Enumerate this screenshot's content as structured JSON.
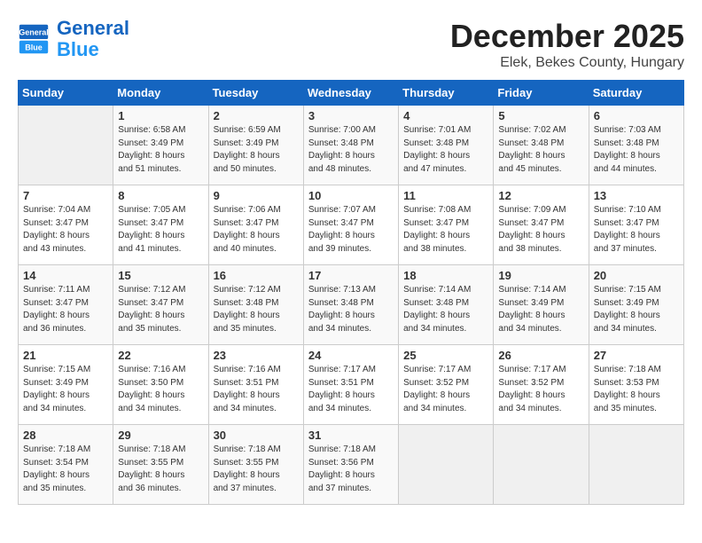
{
  "header": {
    "logo_line1": "General",
    "logo_line2": "Blue",
    "month": "December 2025",
    "location": "Elek, Bekes County, Hungary"
  },
  "days_of_week": [
    "Sunday",
    "Monday",
    "Tuesday",
    "Wednesday",
    "Thursday",
    "Friday",
    "Saturday"
  ],
  "weeks": [
    [
      {
        "day": "",
        "info": ""
      },
      {
        "day": "1",
        "info": "Sunrise: 6:58 AM\nSunset: 3:49 PM\nDaylight: 8 hours\nand 51 minutes."
      },
      {
        "day": "2",
        "info": "Sunrise: 6:59 AM\nSunset: 3:49 PM\nDaylight: 8 hours\nand 50 minutes."
      },
      {
        "day": "3",
        "info": "Sunrise: 7:00 AM\nSunset: 3:48 PM\nDaylight: 8 hours\nand 48 minutes."
      },
      {
        "day": "4",
        "info": "Sunrise: 7:01 AM\nSunset: 3:48 PM\nDaylight: 8 hours\nand 47 minutes."
      },
      {
        "day": "5",
        "info": "Sunrise: 7:02 AM\nSunset: 3:48 PM\nDaylight: 8 hours\nand 45 minutes."
      },
      {
        "day": "6",
        "info": "Sunrise: 7:03 AM\nSunset: 3:48 PM\nDaylight: 8 hours\nand 44 minutes."
      }
    ],
    [
      {
        "day": "7",
        "info": "Sunrise: 7:04 AM\nSunset: 3:47 PM\nDaylight: 8 hours\nand 43 minutes."
      },
      {
        "day": "8",
        "info": "Sunrise: 7:05 AM\nSunset: 3:47 PM\nDaylight: 8 hours\nand 41 minutes."
      },
      {
        "day": "9",
        "info": "Sunrise: 7:06 AM\nSunset: 3:47 PM\nDaylight: 8 hours\nand 40 minutes."
      },
      {
        "day": "10",
        "info": "Sunrise: 7:07 AM\nSunset: 3:47 PM\nDaylight: 8 hours\nand 39 minutes."
      },
      {
        "day": "11",
        "info": "Sunrise: 7:08 AM\nSunset: 3:47 PM\nDaylight: 8 hours\nand 38 minutes."
      },
      {
        "day": "12",
        "info": "Sunrise: 7:09 AM\nSunset: 3:47 PM\nDaylight: 8 hours\nand 38 minutes."
      },
      {
        "day": "13",
        "info": "Sunrise: 7:10 AM\nSunset: 3:47 PM\nDaylight: 8 hours\nand 37 minutes."
      }
    ],
    [
      {
        "day": "14",
        "info": "Sunrise: 7:11 AM\nSunset: 3:47 PM\nDaylight: 8 hours\nand 36 minutes."
      },
      {
        "day": "15",
        "info": "Sunrise: 7:12 AM\nSunset: 3:47 PM\nDaylight: 8 hours\nand 35 minutes."
      },
      {
        "day": "16",
        "info": "Sunrise: 7:12 AM\nSunset: 3:48 PM\nDaylight: 8 hours\nand 35 minutes."
      },
      {
        "day": "17",
        "info": "Sunrise: 7:13 AM\nSunset: 3:48 PM\nDaylight: 8 hours\nand 34 minutes."
      },
      {
        "day": "18",
        "info": "Sunrise: 7:14 AM\nSunset: 3:48 PM\nDaylight: 8 hours\nand 34 minutes."
      },
      {
        "day": "19",
        "info": "Sunrise: 7:14 AM\nSunset: 3:49 PM\nDaylight: 8 hours\nand 34 minutes."
      },
      {
        "day": "20",
        "info": "Sunrise: 7:15 AM\nSunset: 3:49 PM\nDaylight: 8 hours\nand 34 minutes."
      }
    ],
    [
      {
        "day": "21",
        "info": "Sunrise: 7:15 AM\nSunset: 3:49 PM\nDaylight: 8 hours\nand 34 minutes."
      },
      {
        "day": "22",
        "info": "Sunrise: 7:16 AM\nSunset: 3:50 PM\nDaylight: 8 hours\nand 34 minutes."
      },
      {
        "day": "23",
        "info": "Sunrise: 7:16 AM\nSunset: 3:51 PM\nDaylight: 8 hours\nand 34 minutes."
      },
      {
        "day": "24",
        "info": "Sunrise: 7:17 AM\nSunset: 3:51 PM\nDaylight: 8 hours\nand 34 minutes."
      },
      {
        "day": "25",
        "info": "Sunrise: 7:17 AM\nSunset: 3:52 PM\nDaylight: 8 hours\nand 34 minutes."
      },
      {
        "day": "26",
        "info": "Sunrise: 7:17 AM\nSunset: 3:52 PM\nDaylight: 8 hours\nand 34 minutes."
      },
      {
        "day": "27",
        "info": "Sunrise: 7:18 AM\nSunset: 3:53 PM\nDaylight: 8 hours\nand 35 minutes."
      }
    ],
    [
      {
        "day": "28",
        "info": "Sunrise: 7:18 AM\nSunset: 3:54 PM\nDaylight: 8 hours\nand 35 minutes."
      },
      {
        "day": "29",
        "info": "Sunrise: 7:18 AM\nSunset: 3:55 PM\nDaylight: 8 hours\nand 36 minutes."
      },
      {
        "day": "30",
        "info": "Sunrise: 7:18 AM\nSunset: 3:55 PM\nDaylight: 8 hours\nand 37 minutes."
      },
      {
        "day": "31",
        "info": "Sunrise: 7:18 AM\nSunset: 3:56 PM\nDaylight: 8 hours\nand 37 minutes."
      },
      {
        "day": "",
        "info": ""
      },
      {
        "day": "",
        "info": ""
      },
      {
        "day": "",
        "info": ""
      }
    ]
  ]
}
